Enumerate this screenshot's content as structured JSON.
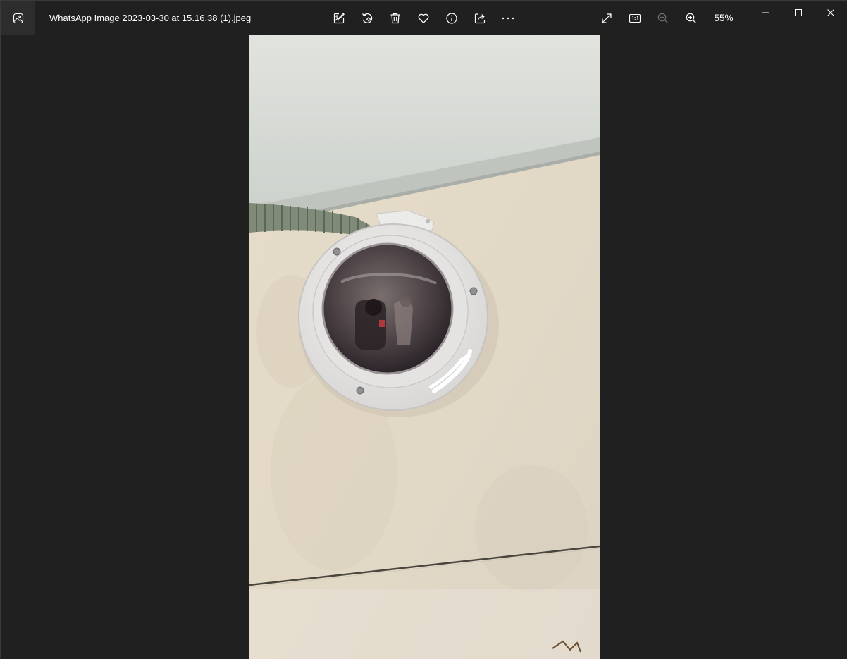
{
  "window": {
    "title": "WhatsApp Image 2023-03-30 at 15.16.38 (1).jpeg"
  },
  "toolbar": {
    "items": [
      {
        "name": "edit-image-icon",
        "label": "Edit image"
      },
      {
        "name": "rotate-icon",
        "label": "Rotate"
      },
      {
        "name": "delete-icon",
        "label": "Delete"
      },
      {
        "name": "favorite-icon",
        "label": "Favorite"
      },
      {
        "name": "file-info-icon",
        "label": "File information"
      },
      {
        "name": "share-icon",
        "label": "Share"
      },
      {
        "name": "more-options-icon",
        "label": "See more"
      }
    ],
    "zoom_level": "55%"
  },
  "window_controls": [
    "minimize",
    "maximize",
    "close"
  ],
  "colors": {
    "background": "#202020",
    "titlebar": "#202020",
    "icon": "#ffffff",
    "icon_disabled": "#6e6e6e"
  }
}
